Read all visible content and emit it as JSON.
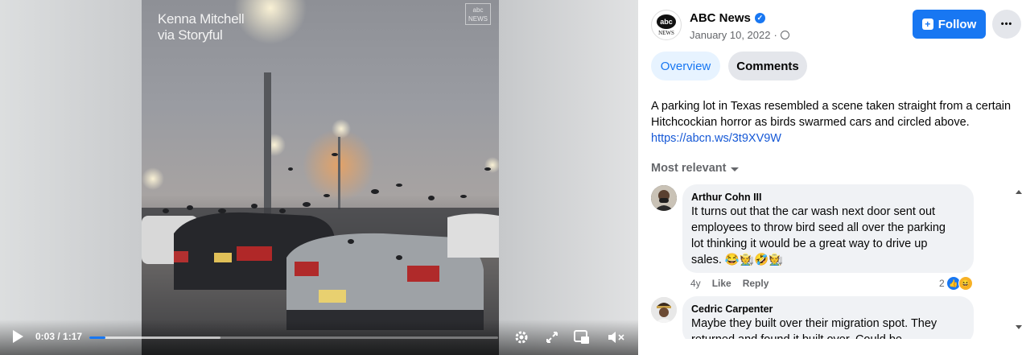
{
  "video": {
    "credit_line1": "Kenna Mitchell",
    "credit_line2": "via Storyful",
    "watermark_logo": "abc",
    "watermark_text": "NEWS",
    "time": "0:03 / 1:17",
    "progress": 0.04,
    "buffered": 0.32
  },
  "post": {
    "page_name": "ABC News",
    "date": "January 10, 2022",
    "date_sep": "·",
    "follow_label": "Follow",
    "more_label": "•••",
    "tabs": [
      {
        "label": "Overview",
        "active": true
      },
      {
        "label": "Comments",
        "active": false
      }
    ],
    "description_line1": "A parking lot in Texas resembled a scene taken straight from a certain",
    "description_line2": "Hitchcockian horror as birds swarmed cars and circled above.",
    "link": "https://abcn.ws/3t9XV9W"
  },
  "comments_section": {
    "sort_label": "Most relevant",
    "comments": [
      {
        "name": "Arthur Cohn III",
        "lines": [
          "It turns out that the car wash next door sent out",
          "employees to throw bird seed all over the parking",
          "lot thinking it would be a great way to drive up",
          "sales. 😂🧑‍🌾🤣🧑‍🌾"
        ],
        "age": "4y",
        "like_label": "Like",
        "reply_label": "Reply",
        "reaction_count": "2"
      },
      {
        "name": "Cedric Carpenter",
        "lines": [
          "Maybe they built over their migration spot. They",
          "returned and found it built over. Could be"
        ]
      }
    ]
  },
  "colors": {
    "accent": "#1877f2",
    "link": "#1558d6",
    "bubble": "#f0f2f5",
    "secondary_text": "#65676b"
  }
}
